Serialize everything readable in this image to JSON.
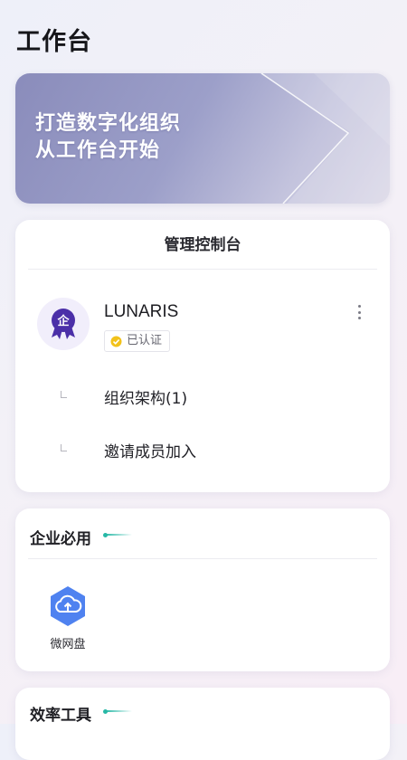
{
  "page": {
    "title": "工作台"
  },
  "banner": {
    "line1": "打造数字化组织",
    "line2": "从工作台开始"
  },
  "console": {
    "title": "管理控制台",
    "org_name": "LUNARIS",
    "org_badge_char": "企",
    "cert_label": "已认证",
    "items": [
      {
        "label": "组织架构(1)"
      },
      {
        "label": "邀请成员加入"
      }
    ]
  },
  "sections": {
    "must_have": {
      "title": "企业必用",
      "apps": [
        {
          "label": "微网盘",
          "icon": "cloud-upload-icon"
        }
      ]
    },
    "tools": {
      "title": "效率工具"
    }
  },
  "colors": {
    "accent": "#26b8a6",
    "badge_purple": "#4b2fa8",
    "app_blue": "#4f82f0",
    "cert_yellow": "#f2c21b"
  }
}
